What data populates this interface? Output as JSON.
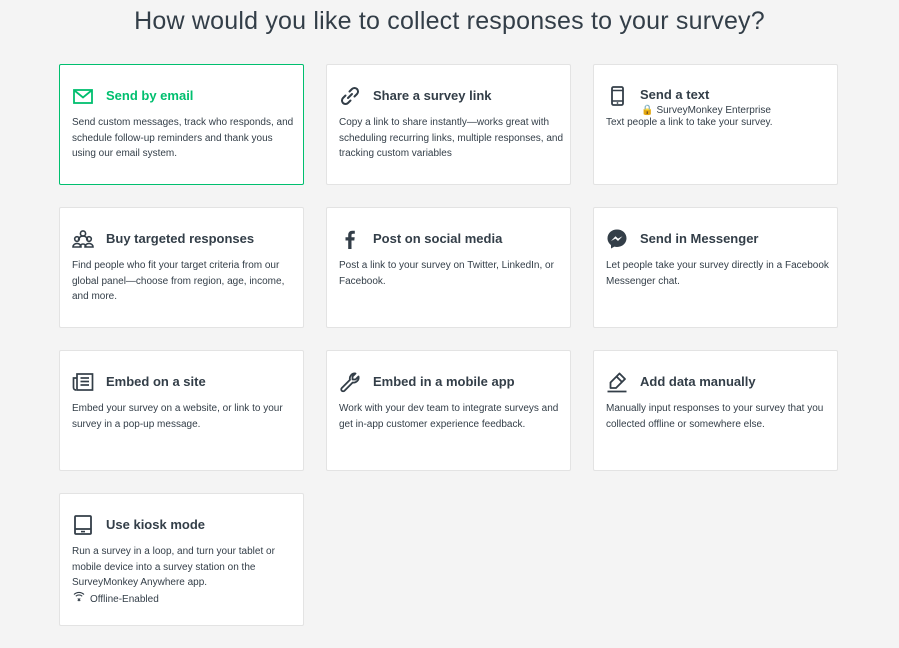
{
  "page": {
    "title": "How would you like to collect responses to your survey?"
  },
  "colors": {
    "accent": "#00bf6f",
    "text": "#333e48",
    "background": "#f4f4f4",
    "lock": "#f5a623"
  },
  "options": [
    {
      "icon": "envelope-icon",
      "title": "Send by email",
      "description": "Send custom messages, track who responds, and schedule follow-up reminders and thank yous using our email system.",
      "selected": true
    },
    {
      "icon": "link-icon",
      "title": "Share a survey link",
      "description": "Copy a link to share instantly—works great with scheduling recurring links, multiple responses, and tracking custom variables"
    },
    {
      "icon": "phone-icon",
      "title": "Send a text",
      "badge": "SurveyMonkey Enterprise",
      "description": "Text people a link to take your survey."
    },
    {
      "icon": "people-icon",
      "title": "Buy targeted responses",
      "description": "Find people who fit your target criteria from our global panel—choose from region, age, income, and more."
    },
    {
      "icon": "facebook-icon",
      "title": "Post on social media",
      "description": "Post a link to your survey on Twitter, LinkedIn, or Facebook."
    },
    {
      "icon": "messenger-icon",
      "title": "Send in Messenger",
      "description": "Let people take your survey directly in a Facebook Messenger chat."
    },
    {
      "icon": "embed-site-icon",
      "title": "Embed on a site",
      "description": "Embed your survey on a website, or link to your survey in a pop-up message."
    },
    {
      "icon": "wrench-icon",
      "title": "Embed in a mobile app",
      "description": "Work with your dev team to integrate surveys and get in-app customer experience feedback."
    },
    {
      "icon": "pencil-icon",
      "title": "Add data manually",
      "description": "Manually input responses to your survey that you collected offline or somewhere else."
    },
    {
      "icon": "tablet-icon",
      "title": "Use kiosk mode",
      "description": "Run a survey in a loop, and turn your tablet or mobile device into a survey station on the SurveyMonkey Anywhere app.",
      "extra": "Offline-Enabled"
    }
  ]
}
